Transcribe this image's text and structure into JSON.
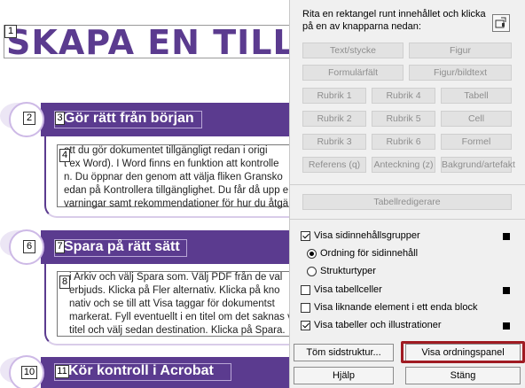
{
  "document": {
    "title": "SKAPA EN TILLGÄN",
    "sections": [
      {
        "number_circle": "2",
        "number_tag": "3",
        "heading": "Gör rätt från början",
        "para_tag": "4",
        "lines": [
          "att du gör dokumentet tillgängligt redan i origi",
          "t ex Word). I Word finns en funktion att kontrolle",
          "n. Du öppnar den genom att välja fliken Gransko",
          "edan på Kontrollera tillgänglighet. Du får då upp e",
          "varningar samt rekommendationer för hur du åtgä"
        ]
      },
      {
        "number_circle": "6",
        "number_tag": "7",
        "heading": "Spara på rätt sätt",
        "para_tag": "8",
        "lines": [
          "i Arkiv och välj Spara som. Välj PDF från de val",
          "erbjuds. Klicka på Fler alternativ. Klicka på  kno",
          "nativ och se till att Visa taggar för dokumentst",
          "markerat. Fyll eventuellt i en titel om det saknas vid L",
          "titel och välj sedan destination. Klicka på Spara."
        ]
      },
      {
        "number_circle": "10",
        "number_tag": "11",
        "heading": "Kör kontroll i Acrobat"
      }
    ],
    "title_tag": "1"
  },
  "panel": {
    "instruction": "Rita en rektangel runt innehållet och klicka på en av knapparna nedan:",
    "tag_buttons": [
      [
        "Text/stycke",
        "Figur"
      ],
      [
        "Formulärfält",
        "Figur/bildtext"
      ],
      [
        "Rubrik 1",
        "Rubrik 4",
        "Tabell"
      ],
      [
        "Rubrik 2",
        "Rubrik 5",
        "Cell"
      ],
      [
        "Rubrik 3",
        "Rubrik 6",
        "Formel"
      ],
      [
        "Referens (q)",
        "Anteckning (z)",
        "Bakgrund/artefakt"
      ]
    ],
    "table_editor_button": "Tabellredigerare",
    "options": {
      "show_content_groups": "Visa sidinnehållsgrupper",
      "order_by_content": "Ordning för sidinnehåll",
      "structure_types": "Strukturtyper",
      "show_table_cells": "Visa tabellceller",
      "show_similar_as_block": "Visa liknande element i ett enda block",
      "show_tables_and_figures": "Visa tabeller och illustrationer"
    },
    "buttons": {
      "clear_structure": "Töm sidstruktur...",
      "show_order_panel": "Visa ordningspanel",
      "help": "Hjälp",
      "close": "Stäng"
    },
    "highlight_color": "#a01b22"
  }
}
